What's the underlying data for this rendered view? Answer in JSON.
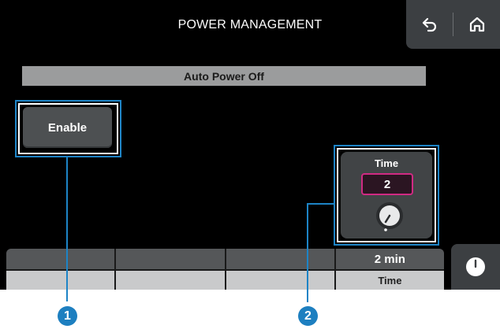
{
  "header": {
    "title": "POWER MANAGEMENT",
    "back_icon": "back-arrow-icon",
    "home_icon": "home-icon"
  },
  "section": {
    "title": "Auto Power Off"
  },
  "enable_button": {
    "label": "Enable"
  },
  "time_control": {
    "label": "Time",
    "value": "2",
    "knob_icon": "rotary-knob-icon"
  },
  "bottom_bar": {
    "cells": [
      {
        "value": "",
        "label": ""
      },
      {
        "value": "",
        "label": ""
      },
      {
        "value": "",
        "label": ""
      },
      {
        "value": "2 min",
        "label": "Time"
      }
    ],
    "clock_icon": "clock-icon"
  },
  "callouts": [
    {
      "number": "1"
    },
    {
      "number": "2"
    }
  ],
  "colors": {
    "accent_highlight": "#1d84c6",
    "value_border": "#d02a83",
    "screen_bg": "#000000"
  }
}
